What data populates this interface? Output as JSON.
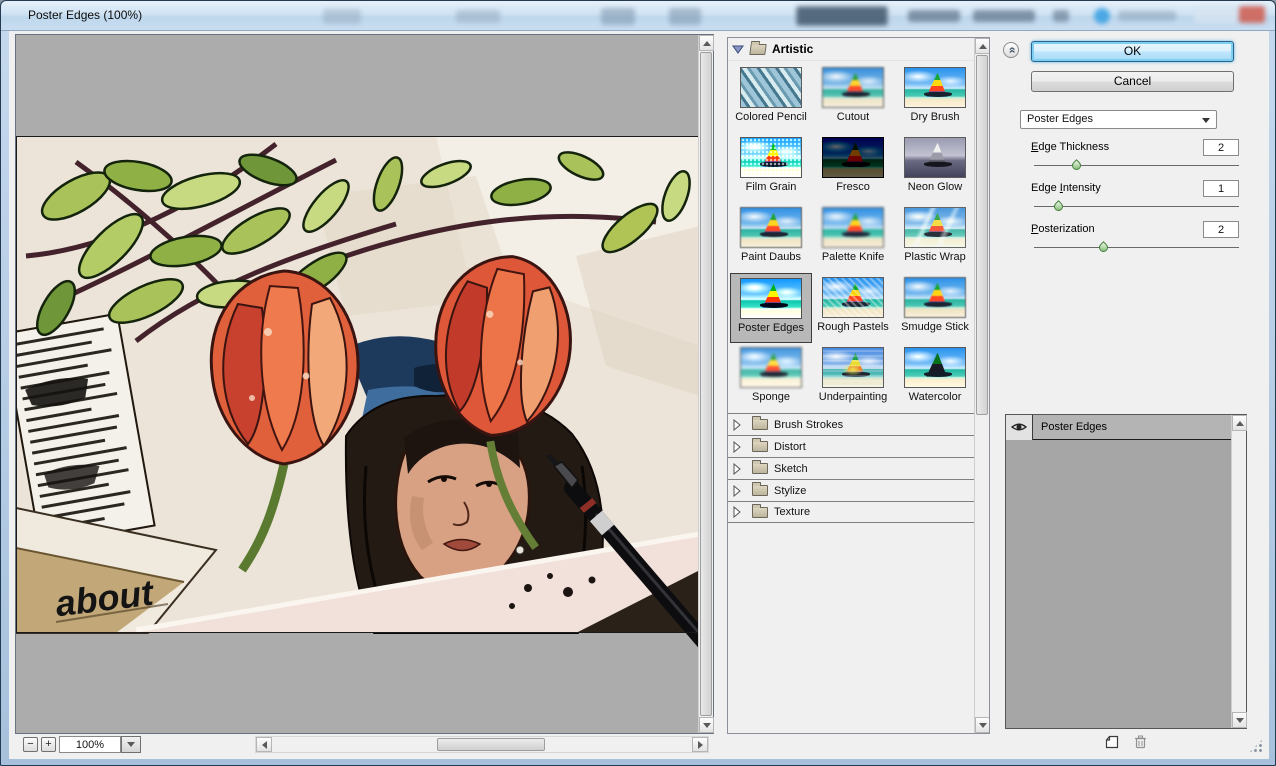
{
  "window": {
    "title": "Poster Edges (100%)"
  },
  "preview": {
    "zoom_out_label": "−",
    "zoom_in_label": "+",
    "zoom_level": "100%",
    "image_caption_text": "about"
  },
  "filter_gallery": {
    "expanded_category": "Artistic",
    "artistic_filters": [
      "Colored Pencil",
      "Cutout",
      "Dry Brush",
      "Film Grain",
      "Fresco",
      "Neon Glow",
      "Paint Daubs",
      "Palette Knife",
      "Plastic Wrap",
      "Poster Edges",
      "Rough Pastels",
      "Smudge Stick",
      "Sponge",
      "Underpainting",
      "Watercolor"
    ],
    "selected_filter": "Poster Edges",
    "collapsed_categories": [
      "Brush Strokes",
      "Distort",
      "Sketch",
      "Stylize",
      "Texture"
    ]
  },
  "controls": {
    "ok_label": "OK",
    "cancel_label": "Cancel",
    "filter_dropdown_value": "Poster Edges",
    "sliders": [
      {
        "before": "",
        "accel": "E",
        "after": "dge Thickness",
        "value": "2"
      },
      {
        "before": "Edge ",
        "accel": "I",
        "after": "ntensity",
        "value": "1"
      },
      {
        "before": "",
        "accel": "P",
        "after": "osterization",
        "value": "2"
      }
    ]
  },
  "effect_layers": {
    "rows": [
      {
        "name": "Poster Edges"
      }
    ]
  },
  "colors": {
    "ok_button_glow": "#7ed0f2",
    "canvas_gray": "#acacac",
    "selected_thumb_bg": "#b8b8b8",
    "slider_thumb_green": "#79b667"
  }
}
